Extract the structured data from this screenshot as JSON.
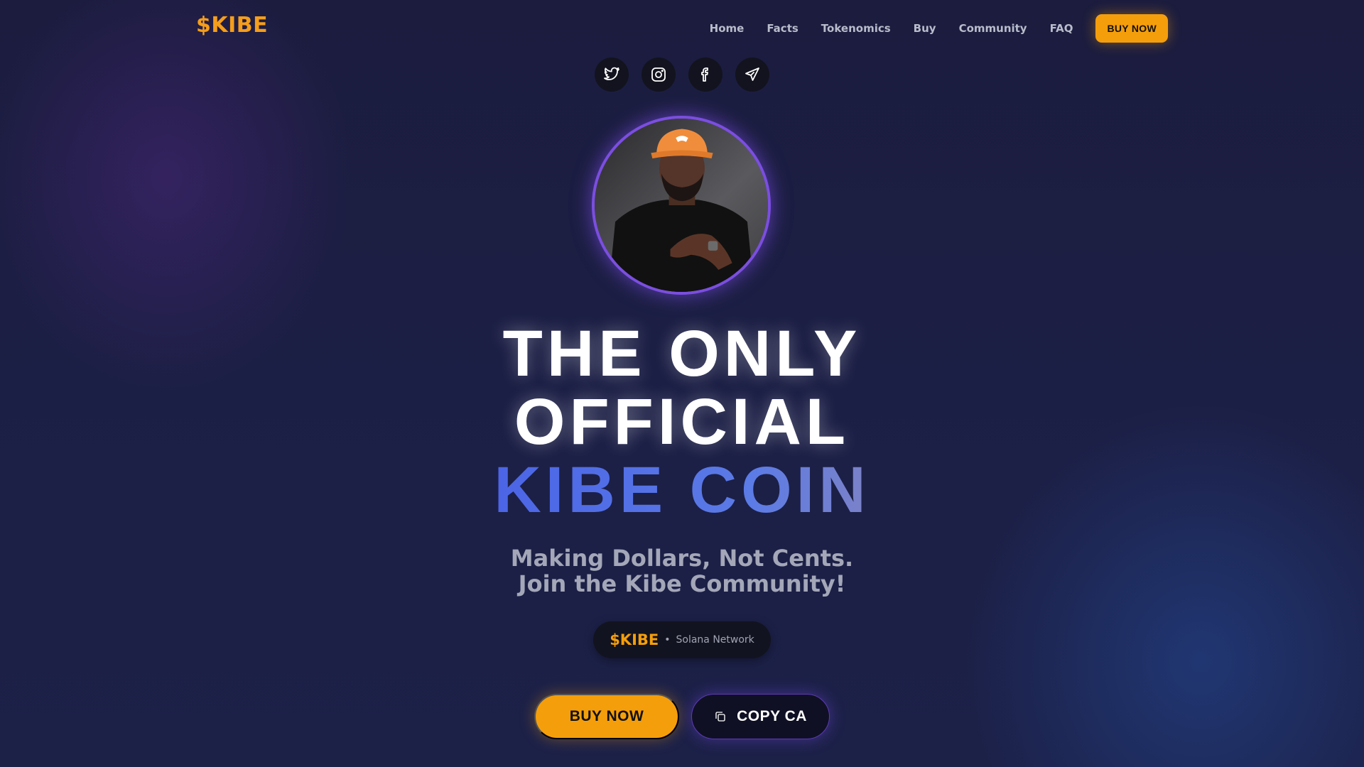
{
  "brand": {
    "logo": "$KIBE",
    "accent": "#f59e0b",
    "purple": "#7b4ee0"
  },
  "nav": {
    "links": [
      "Home",
      "Facts",
      "Tokenomics",
      "Buy",
      "Community",
      "FAQ"
    ],
    "cta": "BUY NOW"
  },
  "socials": [
    {
      "icon": "twitter-icon"
    },
    {
      "icon": "instagram-icon"
    },
    {
      "icon": "facebook-icon"
    },
    {
      "icon": "telegram-icon"
    }
  ],
  "hero": {
    "headline_line1": "THE ONLY",
    "headline_line2": "OFFICIAL",
    "headline_line3": "KIBE COIN",
    "tagline_line1": "Making Dollars, Not Cents.",
    "tagline_line2": "Join the Kibe Community!",
    "ticker_symbol": "$KIBE",
    "ticker_separator": "•",
    "ticker_network": "Solana Network",
    "buy_label": "BUY NOW",
    "copy_label": "COPY CA"
  }
}
